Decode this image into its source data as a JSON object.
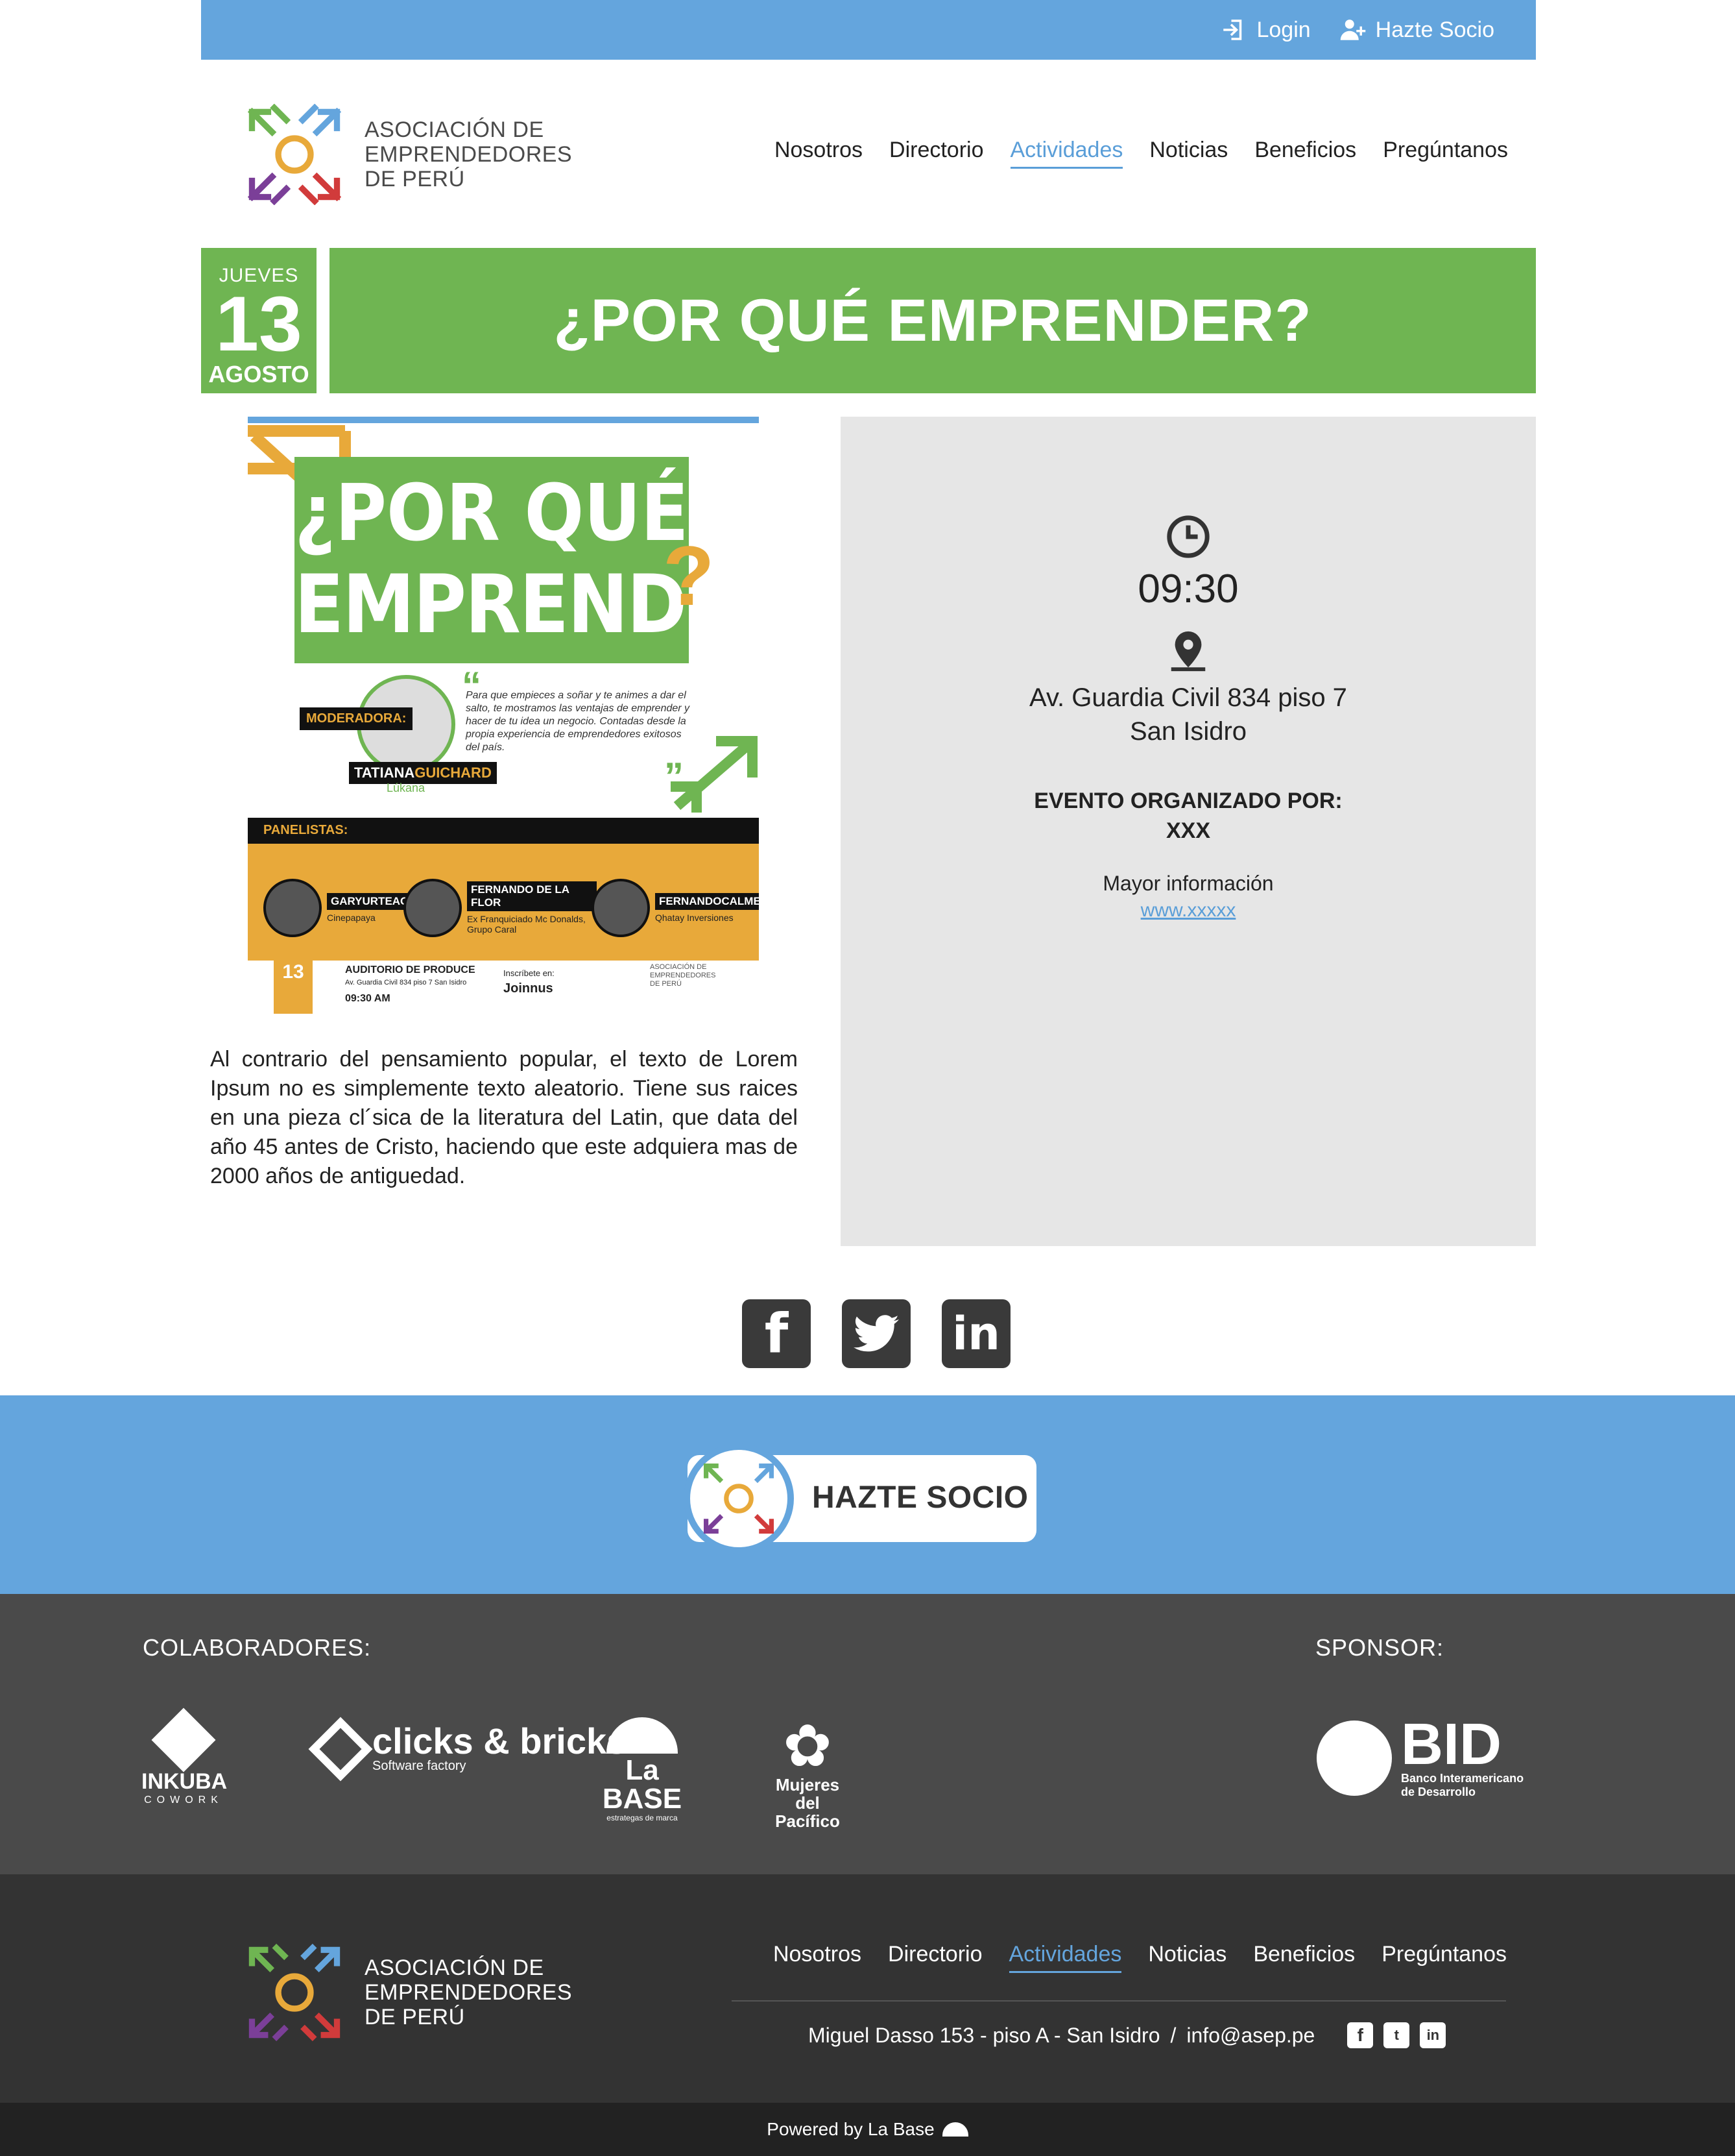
{
  "topbar": {
    "login_label": "Login",
    "join_label": "Hazte Socio"
  },
  "brand": {
    "name_line1": "ASOCIACIÓN DE",
    "name_line2": "EMPRENDEDORES",
    "name_line3": "DE PERÚ"
  },
  "nav": [
    {
      "label": "Nosotros"
    },
    {
      "label": "Directorio"
    },
    {
      "label": "Actividades",
      "active": true
    },
    {
      "label": "Noticias"
    },
    {
      "label": "Beneficios"
    },
    {
      "label": "Pregúntanos"
    }
  ],
  "event": {
    "weekday": "JUEVES",
    "day": "13",
    "month": "AGOSTO",
    "title": "¿POR QUÉ EMPRENDER?",
    "description": "Al contrario del pensamiento popular, el texto de Lorem Ipsum no es simplemente texto aleatorio. Tiene sus raices en una pieza cl´sica de la literatura del Latin, que data del año 45 antes de Cristo, haciendo que este adquiera mas de 2000 años de antiguedad.",
    "time": "09:30",
    "address_line1": "Av. Guardia Civil 834 piso 7",
    "address_line2": "San Isidro",
    "organizer_label": "EVENTO ORGANIZADO POR:",
    "organizer": "XXX",
    "more_info_label": "Mayor información",
    "more_info_url": "www.xxxxx"
  },
  "poster": {
    "line1": "¿POR QUÉ",
    "line2": "EMPRENDER",
    "moderator_label": "MODERADORA:",
    "moderator_first": "TATIANA",
    "moderator_last": "GUICHARD",
    "moderator_company": "Lúkana",
    "quote": "Para que empieces a soñar y te animes a dar el salto, te mostramos las ventajas de emprender y hacer de tu idea un negocio. Contadas desde la propia experiencia de emprendedores exitosos del país.",
    "panel_label": "PANELISTAS:",
    "panelists": [
      {
        "first": "GARY",
        "last": "URTEAGA",
        "company": "Cinepapaya"
      },
      {
        "first": "FERNANDO",
        "last": "DE LA FLOR",
        "company": "Ex Franquiciado Mc Donalds, Grupo Caral"
      },
      {
        "first": "FERNANDO",
        "last": "CALMELL",
        "company": "Qhatay Inversiones"
      }
    ],
    "venue": "AUDITORIO DE PRODUCE",
    "venue_address": "Av. Guardia Civil 834 piso 7 San Isidro",
    "time": "09:30 AM",
    "register_label": "Inscríbete en:",
    "register_site": "Joinnus"
  },
  "cta": {
    "label": "HAZTE SOCIO"
  },
  "collaborators": {
    "heading": "COLABORADORES:",
    "sponsor_heading": "SPONSOR:",
    "logos": [
      {
        "name": "INKUBA",
        "sub": "COWORK"
      },
      {
        "name": "clicks & bricks",
        "sub": "Software factory"
      },
      {
        "name": "La BASE",
        "sub": "estrategas de marca"
      },
      {
        "name": "Mujeres del Pacífico",
        "sub": ""
      }
    ],
    "sponsor": {
      "name": "BID",
      "sub1": "Banco Interamericano",
      "sub2": "de Desarrollo"
    }
  },
  "footer": {
    "address": "Miguel Dasso 153 - piso A - San Isidro",
    "separator": "/",
    "email": "info@asep.pe",
    "powered": "Powered by La Base"
  },
  "colors": {
    "blue": "#64a5dd",
    "green": "#6fb552",
    "yellow": "#e8a93a",
    "panel_gray": "#e6e6e6",
    "dark": "#333333"
  },
  "icons": [
    "login-icon",
    "user-add-icon",
    "clock-icon",
    "location-pin-icon",
    "facebook-icon",
    "twitter-icon",
    "linkedin-icon"
  ]
}
